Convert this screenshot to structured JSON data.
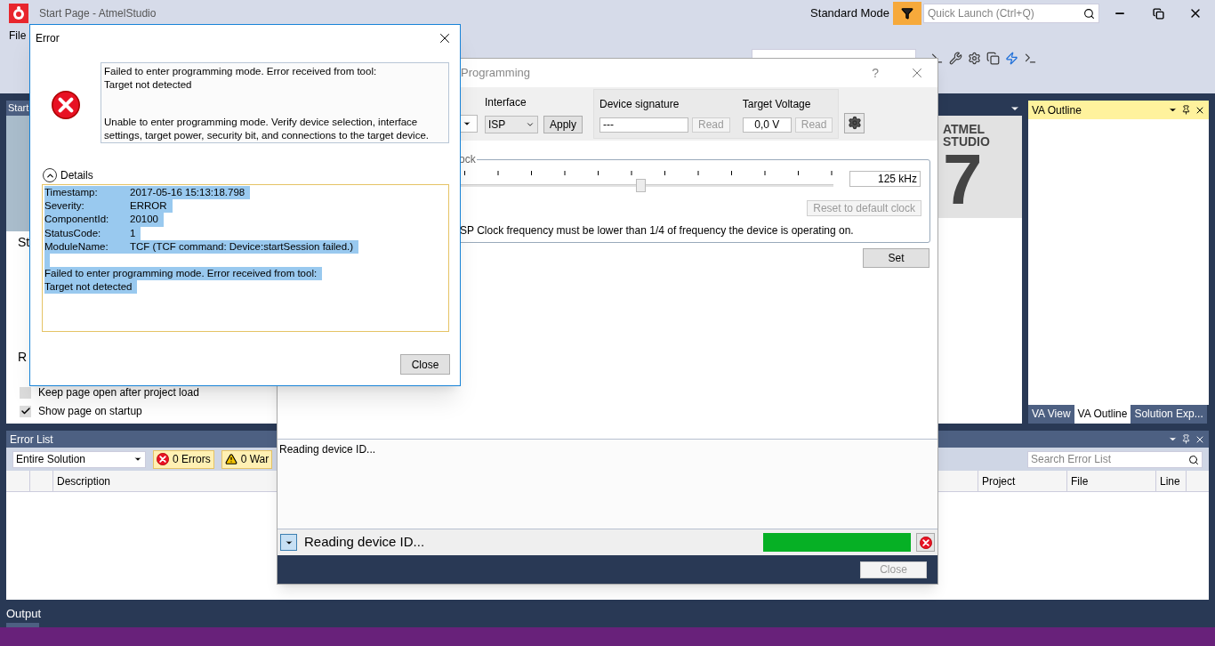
{
  "app": {
    "title": "Start Page - AtmelStudio",
    "mode": "Standard Mode",
    "quick_launch": {
      "placeholder": "Quick Launch (Ctrl+Q)"
    },
    "menu": [
      "File"
    ]
  },
  "start_page": {
    "tab": "Start",
    "heading_1": "St",
    "heading_2": "R",
    "options": [
      {
        "label": "Keep page open after project load",
        "checked": false
      },
      {
        "label": "Show page on startup",
        "checked": true
      }
    ],
    "logo": {
      "line_1": "ATMEL",
      "line_2": "STUDIO",
      "version": "7"
    }
  },
  "va_panel": {
    "title": "VA Outline",
    "tabs": [
      {
        "label": "VA View",
        "selected": false
      },
      {
        "label": "VA Outline",
        "selected": true
      },
      {
        "label": "Solution Exp...",
        "selected": false
      }
    ]
  },
  "error_list": {
    "title": "Error List",
    "scope": "Entire Solution",
    "filters": [
      {
        "kind": "error",
        "label": "0 Errors"
      },
      {
        "kind": "warning",
        "label": "0 War"
      }
    ],
    "search": {
      "placeholder": "Search Error List"
    },
    "columns": [
      "Description",
      "Project",
      "File",
      "Line"
    ]
  },
  "output_tab": "Output",
  "programming_dialog": {
    "title": "Programming",
    "interface": {
      "label": "Interface",
      "value": "ISP",
      "apply": "Apply"
    },
    "device_signature": {
      "label": "Device signature",
      "value": "---",
      "read": "Read",
      "read_disabled": true
    },
    "target_voltage": {
      "label": "Target Voltage",
      "value": "0,0 V",
      "read": "Read",
      "read_disabled": true
    },
    "clock": {
      "label": "ock",
      "level": 0.64,
      "value": "125 kHz",
      "reset": "Reset to default clock",
      "reset_disabled": true,
      "note": "SP Clock frequency must be lower than 1/4 of frequency the device is operating on.",
      "set": "Set"
    },
    "log": [
      "Reading device ID..."
    ],
    "status": {
      "text": "Reading device ID...",
      "level": 1
    },
    "close": "Close",
    "close_disabled": true,
    "help": "?"
  },
  "error_dialog": {
    "title": "Error",
    "message": [
      "Failed to enter programming mode. Error received from tool:\nTarget not detected",
      "Unable to enter programming mode. Verify device selection, interface settings, target power, security bit, and connections to the target device."
    ],
    "details": {
      "label": "Details",
      "expanded": true,
      "selected": true,
      "fields": [
        {
          "key": "Timestamp:",
          "value": "2017-05-16 15:13:18.798"
        },
        {
          "key": "Severity:",
          "value": "ERROR"
        },
        {
          "key": "ComponentId:",
          "value": "20100"
        },
        {
          "key": "StatusCode:",
          "value": "1"
        },
        {
          "key": "ModuleName:",
          "value": "TCF (TCF command: Device:startSession failed.)"
        }
      ],
      "message": [
        "Failed to enter programming mode. Error received from tool:",
        "Target not detected"
      ]
    },
    "close": "Close"
  }
}
